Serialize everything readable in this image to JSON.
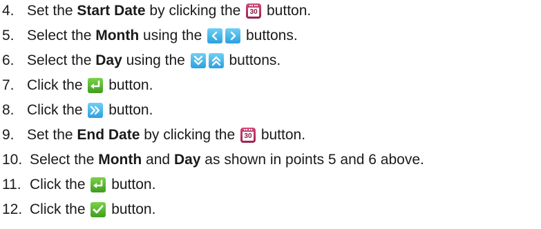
{
  "steps": [
    {
      "num": "4.",
      "pre": "Set the ",
      "bold": "Start Date",
      "mid": " by clicking the ",
      "post": " button.",
      "icons": [
        "calendar-icon"
      ]
    },
    {
      "num": "5.",
      "pre": "Select the ",
      "bold": "Month",
      "mid": " using the ",
      "post": " buttons.",
      "icons": [
        "arrow-left-icon",
        "arrow-right-icon"
      ]
    },
    {
      "num": "6.",
      "pre": "Select the ",
      "bold": "Day",
      "mid": " using the ",
      "post": " buttons.",
      "icons": [
        "double-chevron-down-icon",
        "double-chevron-up-icon"
      ]
    },
    {
      "num": "7.",
      "pre": "Click the ",
      "post": " button.",
      "icons": [
        "enter-icon"
      ]
    },
    {
      "num": "8.",
      "pre": "Click the ",
      "post": " button.",
      "icons": [
        "double-chevron-right-icon"
      ]
    },
    {
      "num": "9.",
      "pre": "Set the ",
      "bold": "End Date",
      "mid": " by clicking the ",
      "post": " button.",
      "icons": [
        "calendar-icon"
      ]
    },
    {
      "num": "10.",
      "pre": "Select the ",
      "bold": "Month",
      "mid": " and ",
      "bold2": "Day",
      "post": " as shown in points 5 and 6 above."
    },
    {
      "num": "11.",
      "pre": "Click the ",
      "post": " button.",
      "icons": [
        "enter-icon"
      ]
    },
    {
      "num": "12.",
      "pre": "Click the ",
      "post": " button.",
      "icons": [
        "checkmark-icon"
      ]
    }
  ],
  "calendar_icon_text": "30",
  "colors": {
    "text": "#1a1a1a",
    "calendar": "#b5305f",
    "blue_button": "#3bb0e8",
    "green_button": "#52b02a"
  }
}
